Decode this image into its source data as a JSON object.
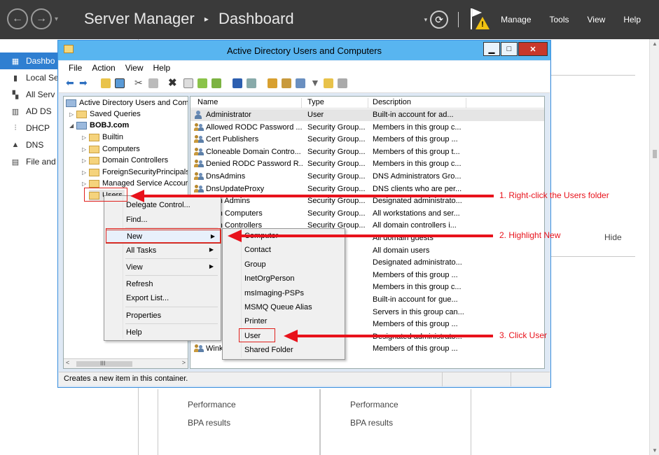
{
  "server_manager": {
    "title": "Server Manager",
    "breadcrumb_sep": "▸",
    "page": "Dashboard",
    "nav_dropdown": "▾",
    "menu": [
      "Manage",
      "Tools",
      "View",
      "Help"
    ],
    "sidebar": [
      {
        "label": "Dashbo",
        "icon": "dashboard-icon",
        "glyph": "▦",
        "active": true
      },
      {
        "label": "Local Se",
        "icon": "local-server-icon",
        "glyph": "▮",
        "active": false
      },
      {
        "label": "All Serv",
        "icon": "all-servers-icon",
        "glyph": "▚",
        "active": false
      },
      {
        "label": "AD DS",
        "icon": "ad-ds-icon",
        "glyph": "▥",
        "active": false
      },
      {
        "label": "DHCP",
        "icon": "dhcp-icon",
        "glyph": "⫶",
        "active": false
      },
      {
        "label": "DNS",
        "icon": "dns-icon",
        "glyph": "▲",
        "active": false
      },
      {
        "label": "File and",
        "icon": "file-services-icon",
        "glyph": "▤",
        "active": false
      }
    ],
    "hide_label": "Hide",
    "tiles": [
      {
        "line1": "Performance",
        "line2": "BPA results"
      },
      {
        "line1": "Performance",
        "line2": "BPA results"
      }
    ]
  },
  "aduc": {
    "title": "Active Directory Users and Computers",
    "menubar": [
      "File",
      "Action",
      "View",
      "Help"
    ],
    "tree": {
      "root": "Active Directory Users and Com",
      "items": [
        {
          "label": "Saved Queries"
        },
        {
          "label": "BOBJ.com"
        },
        {
          "label": "Builtin"
        },
        {
          "label": "Computers"
        },
        {
          "label": "Domain Controllers"
        },
        {
          "label": "ForeignSecurityPrincipals"
        },
        {
          "label": "Managed Service Accour"
        },
        {
          "label": "Users"
        }
      ]
    },
    "columns": {
      "name": "Name",
      "type": "Type",
      "description": "Description"
    },
    "rows": [
      {
        "name": "Administrator",
        "type": "User",
        "description": "Built-in account for ad..."
      },
      {
        "name": "Allowed RODC Password ...",
        "type": "Security Group...",
        "description": "Members in this group c..."
      },
      {
        "name": "Cert Publishers",
        "type": "Security Group...",
        "description": "Members of this group ..."
      },
      {
        "name": "Cloneable Domain Contro...",
        "type": "Security Group...",
        "description": "Members of this group t..."
      },
      {
        "name": "Denied RODC Password R...",
        "type": "Security Group...",
        "description": "Members in this group c..."
      },
      {
        "name": "DnsAdmins",
        "type": "Security Group...",
        "description": "DNS Administrators Gro..."
      },
      {
        "name": "DnsUpdateProxy",
        "type": "Security Group...",
        "description": "DNS clients who are per..."
      },
      {
        "name": "main Admins",
        "type": "Security Group...",
        "description": "Designated administrato..."
      },
      {
        "name": "main Computers",
        "type": "Security Group...",
        "description": "All workstations and ser..."
      },
      {
        "name": "main Controllers",
        "type": "Security Group...",
        "description": "All domain controllers i..."
      },
      {
        "name": "",
        "type": "oup...",
        "description": "All domain guests"
      },
      {
        "name": "",
        "type": "oup...",
        "description": "All domain users"
      },
      {
        "name": "",
        "type": "oup...",
        "description": "Designated administrato..."
      },
      {
        "name": "",
        "type": "oup...",
        "description": "Members of this group ..."
      },
      {
        "name": "",
        "type": "oup...",
        "description": "Members in this group c..."
      },
      {
        "name": "",
        "type": "",
        "description": "Built-in account for gue..."
      },
      {
        "name": "",
        "type": "oup...",
        "description": "Servers in this group can..."
      },
      {
        "name": "",
        "type": "oup...",
        "description": "Members of this group ..."
      },
      {
        "name": "",
        "type": "oup...",
        "description": "Designated administrato..."
      },
      {
        "name": "Wink",
        "type": "oup...",
        "description": "Members of this group ..."
      }
    ],
    "status": "Creates a new item in this container.",
    "hscroll_mid": "III",
    "context_menu": {
      "items": [
        "Delegate Control...",
        "Find...",
        "New",
        "All Tasks",
        "View",
        "Refresh",
        "Export List...",
        "Properties",
        "Help"
      ]
    },
    "new_submenu": {
      "items": [
        "Computer",
        "Contact",
        "Group",
        "InetOrgPerson",
        "msImaging-PSPs",
        "MSMQ Queue Alias",
        "Printer",
        "User",
        "Shared Folder"
      ]
    }
  },
  "annotations": {
    "step1": "1. Right-click the Users folder",
    "step2": "2. Highlight New",
    "step3": "3. Click User",
    "color": "#e8121b"
  }
}
